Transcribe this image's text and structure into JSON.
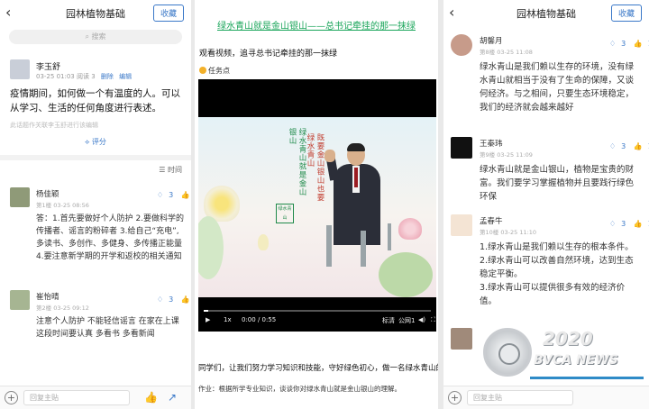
{
  "left": {
    "header": {
      "title": "园林植物基础",
      "favorite_label": "收藏"
    },
    "search_placeholder": "搜索",
    "post": {
      "author": "李玉舒",
      "time": "03-25 01:03",
      "reads": "03-25 01:03  阅读 3",
      "edit_labels": [
        "删除",
        "编辑"
      ],
      "body": "疫情期间，如何做一个有温度的人。可以从学习、生活的任何角度进行表述。",
      "note": "此话题作关联李玉舒进行该编辑",
      "rate_label": "评分"
    },
    "sort_label": "时间",
    "replies": [
      {
        "name": "杨佳颖",
        "floor": "第1楼",
        "time": "03-25 08:56",
        "likes": "3",
        "thumbs": "1",
        "body": "答：1.首先要做好个人防护 2.要做科学的传播者、谣言的粉碎者 3.给自己“充电”,多读书、多创作、多健身、多传播正能量 4.要注意新学期的开学和返校的相关通知"
      },
      {
        "name": "崔怡晴",
        "floor": "第2楼",
        "time": "03-25 09:12",
        "likes": "3",
        "thumbs": "1",
        "body": "注意个人防护 不能轻信谣言 在家在上课这段时间要认真 多看书 多看新闻"
      }
    ],
    "reply_placeholder": "回复主贴"
  },
  "middle": {
    "title": "绿水青山就是金山银山——总书记牵挂的那一抹绿",
    "subtitle": "观看视频，追寻总书记牵挂的那一抹绿",
    "task_label": "任务点",
    "video": {
      "poem_right": "既要金山银山也要绿水青山",
      "poem_left": "绿水青山就是金山银山",
      "time": "0:00 / 0:55",
      "speed": "1x",
      "quality": "标清",
      "line": "公网1",
      "seal": "绿水青山"
    },
    "text": "同学们，让我们努力学习知识和技能，守好绿色初心，做一名绿水青山的建设者。",
    "homework": "作业：根据所学专业知识，谈谈你对绿水青山就是金山银山的理解。"
  },
  "right": {
    "header": {
      "title": "园林植物基础",
      "favorite_label": "收藏"
    },
    "replies": [
      {
        "name": "胡馨月",
        "floor": "第8楼",
        "time": "03-25 11:08",
        "likes": "3",
        "thumbs": "1",
        "body": "绿水青山是我们赖以生存的环境，没有绿水青山就相当于没有了生命的保障，又谈何经济。与之相间，只要生态环境稳定，我们的经济就会越来越好"
      },
      {
        "name": "王秦玮",
        "floor": "第9楼",
        "time": "03-25 11:09",
        "likes": "3",
        "thumbs": "1",
        "body": "绿水青山就是金山银山，植物是宝贵的财富。我们要学习掌握植物并且要践行绿色环保"
      },
      {
        "name": "孟春牛",
        "floor": "第10楼",
        "time": "03-25 11:10",
        "likes": "3",
        "thumbs": "1",
        "body": "1.绿水青山是我们赖以生存的根本条件。\n2.绿水青山可以改善自然环境，达到生态稳定平衡。\n3.绿水青山可以提供很多有效的经济价值。"
      }
    ],
    "reply_placeholder": "回复主贴",
    "watermark": {
      "year": "2020",
      "name": "BVCA NEWS"
    }
  },
  "colors": {
    "accent": "#3a78c8",
    "green_title": "#1aa55a"
  }
}
